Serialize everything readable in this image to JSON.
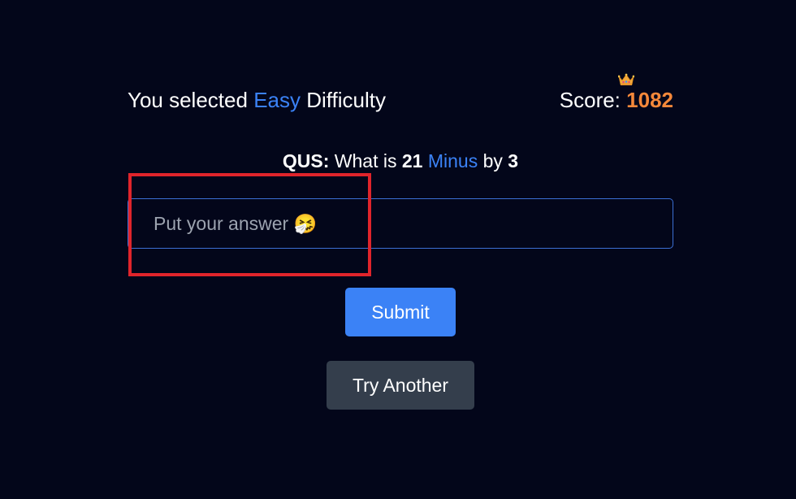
{
  "difficulty": {
    "prefix": "You selected",
    "level": "Easy",
    "suffix": "Difficulty"
  },
  "score": {
    "label": "Score:",
    "value": "1082",
    "icon": "crown-icon"
  },
  "question": {
    "label": "QUS:",
    "text_before": "What is",
    "operand_a": "21",
    "operation": "Minus",
    "text_by": "by",
    "operand_b": "3"
  },
  "answer": {
    "placeholder": "Put your answer 🤧",
    "value": ""
  },
  "buttons": {
    "submit": "Submit",
    "try_another": "Try Another"
  },
  "colors": {
    "background": "#03061a",
    "accent_blue": "#3b82f6",
    "score_orange": "#f5883a",
    "secondary_button": "#343e4c",
    "highlight_red": "#e0242b"
  }
}
